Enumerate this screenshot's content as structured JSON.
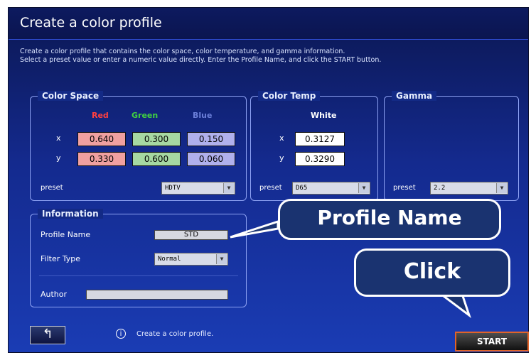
{
  "window": {
    "title": "Create a color profile"
  },
  "description": {
    "line1": "Create a color profile that contains the color space, color temperature, and gamma information.",
    "line2": "Select a preset value or enter a numeric value directly. Enter the Profile Name, and click the START button."
  },
  "color_space": {
    "label": "Color Space",
    "red": "Red",
    "green": "Green",
    "blue": "Blue",
    "x_label": "x",
    "y_label": "y",
    "x_red": "0.640",
    "x_green": "0.300",
    "x_blue": "0.150",
    "y_red": "0.330",
    "y_green": "0.600",
    "y_blue": "0.060",
    "preset_label": "preset",
    "preset_value": "HDTV"
  },
  "color_temp": {
    "label": "Color Temp",
    "white": "White",
    "x_label": "x",
    "y_label": "y",
    "x": "0.3127",
    "y": "0.3290",
    "preset_label": "preset",
    "preset_value": "D65"
  },
  "gamma": {
    "label": "Gamma",
    "preset_label": "preset",
    "preset_value": "2.2"
  },
  "information": {
    "label": "Information",
    "profile_name_label": "Profile Name",
    "profile_name_value": "STD",
    "filter_type_label": "Filter Type",
    "filter_type_value": "Normal",
    "author_label": "Author",
    "author_value": ""
  },
  "callouts": {
    "profile_name": "Profile Name",
    "click": "Click"
  },
  "status": {
    "text": "Create a color profile."
  },
  "buttons": {
    "start": "START",
    "back_icon": "back-arrow-icon"
  },
  "colors": {
    "red": "#f0a0a0",
    "green": "#a6d8a2",
    "blue": "#b0b0ec",
    "accent": "#e0632a"
  }
}
